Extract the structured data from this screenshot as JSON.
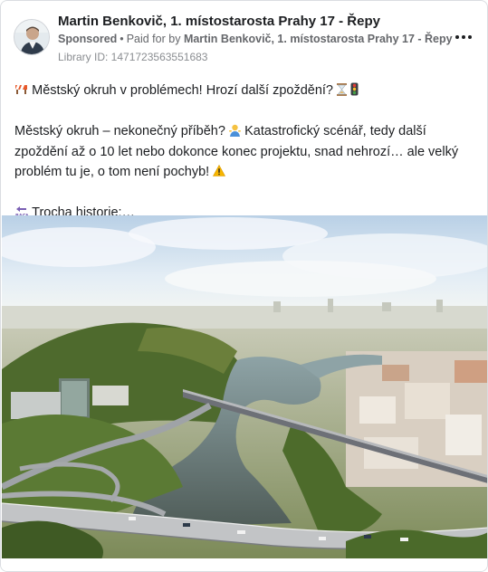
{
  "post": {
    "author": "Martin Benkovič, 1. místostarosta Prahy 17 - Řepy",
    "sponsored_label": "Sponsored",
    "dot": "•",
    "paid_for_prefix": "Paid for by",
    "payer": "Martin Benkovič, 1. místostarosta Prahy 17 - Řepy",
    "library_id": "Library ID: 1471723563551683",
    "more_icon": "more-horizontal-icon",
    "line1_text": "Městský okruh v problémech! Hrozí další zpoždění?",
    "line2_text": "Městský okruh – nekonečný příběh?",
    "line2_text_b": "Katastrofický scénář, tedy další zpoždění až o 10 let nebo dokonce konec projektu, snad nehrozí… ale velký problém tu je, o tom není pochyb!",
    "line3_text": "Trocha historie:…",
    "emojis": {
      "barrier": "construction-barrier-icon",
      "hourglass": "hourglass-icon",
      "traffic_light": "traffic-light-icon",
      "person": "person-shrugging-icon",
      "warning": "warning-icon",
      "back": "back-arrow-icon"
    }
  },
  "colors": {
    "name": "#1c1e21",
    "meta": "#65676b",
    "warning": "#f7b500",
    "river": "#5b6f6e",
    "sky": "#c9dced"
  }
}
